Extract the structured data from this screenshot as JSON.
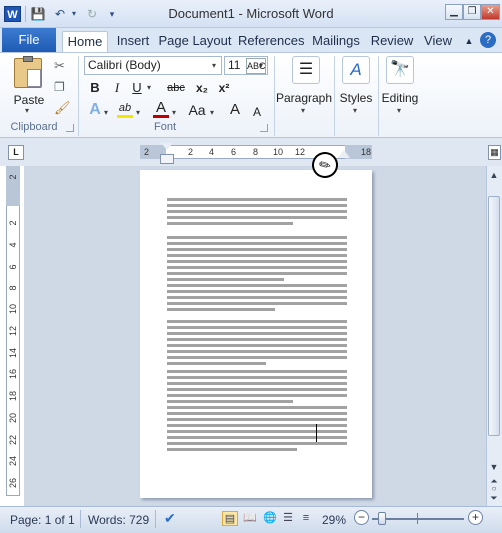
{
  "titlebar": {
    "title": "Document1  -  Microsoft Word",
    "app_icon": "W"
  },
  "qat": {
    "save": "save-icon",
    "undo": "undo-icon",
    "redo": "redo-icon",
    "customize": "customize-icon"
  },
  "tabs": [
    {
      "label": "File"
    },
    {
      "label": "Home"
    },
    {
      "label": "Insert"
    },
    {
      "label": "Page Layout"
    },
    {
      "label": "References"
    },
    {
      "label": "Mailings"
    },
    {
      "label": "Review"
    },
    {
      "label": "View"
    }
  ],
  "ribbon": {
    "clipboard": {
      "paste": "Paste",
      "group": "Clipboard"
    },
    "font": {
      "name": "Calibri (Body)",
      "size": "11",
      "group": "Font",
      "bold": "B",
      "italic": "I",
      "underline": "U",
      "strike": "abc",
      "sub": "x₂",
      "sup": "x²",
      "grow": "A",
      "shrink": "A",
      "case": "Aa"
    },
    "paragraph": "Paragraph",
    "styles": "Styles",
    "editing": "Editing"
  },
  "ruler": {
    "corner": "L",
    "h_ticks": [
      "2",
      "2",
      "4",
      "6",
      "8",
      "10",
      "12",
      "14",
      "",
      "18"
    ],
    "v_ticks": [
      "2",
      "2",
      "4",
      "6",
      "8",
      "10",
      "12",
      "14",
      "16",
      "18",
      "20",
      "22",
      "24",
      "26"
    ]
  },
  "status": {
    "page": "Page: 1 of 1",
    "words": "Words: 729",
    "zoom": "29%",
    "minus": "−",
    "plus": "+"
  }
}
